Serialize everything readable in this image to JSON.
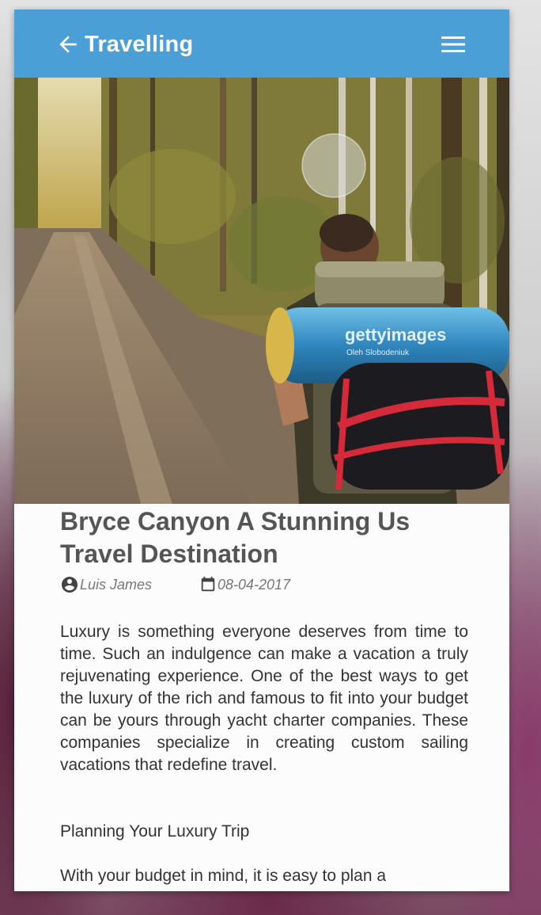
{
  "appbar": {
    "title": "Travelling",
    "back_icon": "arrow-left-icon",
    "menu_icon": "hamburger-menu-icon",
    "color": "#4a9fd6"
  },
  "hero": {
    "watermark_brand": "gettyimages",
    "watermark_credit": "Oleh Slobodeniuk"
  },
  "article": {
    "title": "Bryce Canyon A Stunning Us Travel Destination",
    "author": "Luis James",
    "author_icon": "account-circle-icon",
    "date": "08-04-2017",
    "date_icon": "calendar-icon",
    "paragraph_1": "Luxury is something everyone deserves from time to time. Such an indulgence can make a vacation a truly rejuvenating experience. One of the best ways to get the luxury of the rich and famous to fit into your budget can be yours through yacht charter companies. These companies specialize in creating custom sailing vacations that redefine travel.",
    "subheading": "Planning Your Luxury Trip",
    "paragraph_2": "With your budget in mind, it is easy to plan a"
  }
}
